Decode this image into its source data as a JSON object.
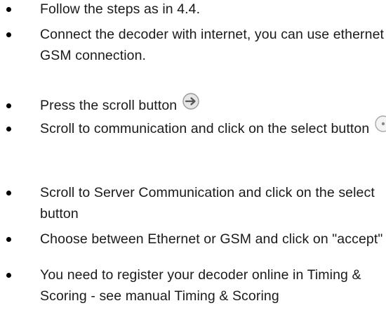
{
  "steps": [
    {
      "text": "Follow the steps as in 4.4."
    },
    {
      "text": "Connect the decoder with internet, you can use ethernet or GSM connection."
    },
    {
      "text": "Press the scroll button",
      "icon": "arrow-right-circle-icon"
    },
    {
      "text": "Scroll to communication and click on the select button",
      "icon": "select-dot-circle-icon"
    },
    {
      "text": "Scroll to Server Communication and click on the select button"
    },
    {
      "text": "Choose between Ethernet or GSM and click on \"accept\""
    },
    {
      "text": "You need to register your decoder online in Timing & Scoring - see manual Timing & Scoring"
    }
  ],
  "icon_colors": {
    "ring": "#9a9a9a",
    "fill": "#e6e6e6",
    "arrow": "#555555"
  }
}
